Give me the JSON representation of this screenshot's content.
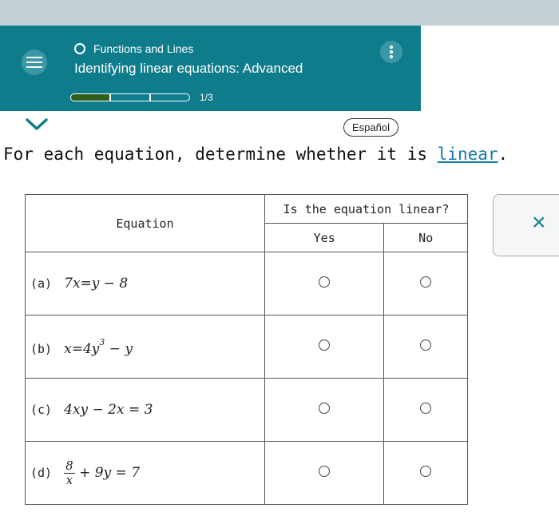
{
  "header": {
    "topic": "Functions and Lines",
    "title": "Identifying linear equations: Advanced",
    "progress_text": "1/3",
    "progress_fraction": 0.333,
    "accent_color": "#0f7c8c"
  },
  "language_button": "Español",
  "question": {
    "prefix": "For each equation, determine whether it is ",
    "link": "linear",
    "suffix": "."
  },
  "table": {
    "equation_header": "Equation",
    "linear_header": "Is the equation linear?",
    "yes_header": "Yes",
    "no_header": "No",
    "rows": [
      {
        "label": "(a)",
        "lhs": "7x",
        "rhs": "y − 8"
      },
      {
        "label": "(b)",
        "lhs": "x",
        "coef": "4y",
        "exp": "3",
        "rest": " − y"
      },
      {
        "label": "(c)",
        "expr": "4xy − 2x = 3"
      },
      {
        "label": "(d)",
        "num": "8",
        "den": "x",
        "rest": "+ 9y = 7"
      }
    ]
  },
  "close_symbol": "×",
  "icons": [
    "hamburger-icon",
    "circle-icon",
    "kebab-icon",
    "chevron-down-icon",
    "close-icon"
  ]
}
